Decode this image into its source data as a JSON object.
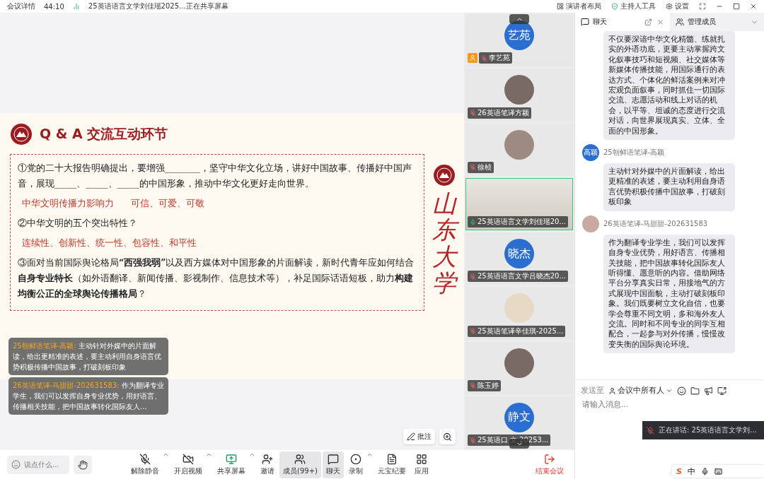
{
  "top_bar": {
    "meeting_info": "会议详情",
    "duration": "44:10",
    "title": "25英语语言文学刘佳瑶2025...正在共享屏幕",
    "actions": [
      {
        "kind": "layout",
        "label": "演讲者布局"
      },
      {
        "kind": "host",
        "label": "主持人工具"
      },
      {
        "kind": "settings",
        "label": "设置"
      }
    ]
  },
  "slide": {
    "title": "Q & A 交流互动环节",
    "side_text": "山东大学",
    "items": [
      {
        "kind": "question",
        "text": "①党的二十大报告明确提出，要增强________，坚守中华文化立场，讲好中国故事、传播好中国声音，展现_____、_____、_____的中国形象，推动中华文化更好走向世界。"
      },
      {
        "kind": "answer",
        "parts": [
          "中华文明传播力影响力",
          "可信、可爱、可敬"
        ]
      },
      {
        "kind": "question",
        "text": "②中华文明的五个突出特性？"
      },
      {
        "kind": "answer",
        "parts": [
          "连续性、创新性、统一性、包容性、和平性"
        ]
      },
      {
        "kind": "question",
        "text": "③面对当前国际舆论格局**“西强我弱”**以及西方媒体对中国形象的片面解读，新时代青年应如何结合**自身专业特长**（如外语翻译、新闻传播、影视制作、信息技术等），补足国际话语短板，助力**构建均衡公正的全球舆论传播格局**？"
      }
    ]
  },
  "overlay_messages": [
    {
      "sender": "25朝鲜语笔译-高颖:",
      "text": "主动针对外媒中的片面解读，给出更精准的表述，要主动利用自身语言优势积极传播中国故事，打破刻板印象"
    },
    {
      "sender": "26英语笔译-马甜甜-202631583:",
      "text": "作为翻译专业学生，我们可以发挥自身专业优势，用好语言、传播相关技能，把中国故事转化国际友人..."
    }
  ],
  "annotate": {
    "label": "批注"
  },
  "participants": [
    {
      "kind": "avatar",
      "avatar_text": "艺苑",
      "name": "李艺苑",
      "muted": true,
      "host": true,
      "speaking": false
    },
    {
      "kind": "photo",
      "name": "26英语笔译方颖",
      "muted": true,
      "host": false,
      "speaking": false
    },
    {
      "kind": "photo",
      "name": "徐桢",
      "muted": true,
      "host": false,
      "speaking": false
    },
    {
      "kind": "video",
      "name": "25英语语言文学刘佳瑶20...",
      "muted": false,
      "host": false,
      "speaking": true
    },
    {
      "kind": "avatar",
      "avatar_text": "晓杰",
      "name": "25英语语言文学吕晓杰20...",
      "muted": true,
      "host": false,
      "speaking": false
    },
    {
      "kind": "photo",
      "name": "25英语笔译辛佳琪-2025...",
      "muted": true,
      "host": false,
      "speaking": false
    },
    {
      "kind": "photo",
      "name": "陈玉婷",
      "muted": true,
      "host": false,
      "speaking": false
    },
    {
      "kind": "avatar",
      "avatar_text": "静文",
      "name": "25英语口 文 20253...",
      "muted": true,
      "host": false,
      "speaking": false
    }
  ],
  "toolbar": {
    "chat_placeholder": "说点什么...",
    "buttons": [
      {
        "kind": "unmute",
        "label": "解除静音",
        "menu": true,
        "active": false
      },
      {
        "kind": "video",
        "label": "开启视频",
        "menu": true,
        "active": false
      },
      {
        "kind": "share",
        "label": "共享屏幕",
        "menu": true,
        "active": false
      },
      {
        "kind": "invite",
        "label": "邀请",
        "menu": false,
        "active": false
      },
      {
        "kind": "members",
        "label": "成员(99+)",
        "menu": false,
        "active": true
      },
      {
        "kind": "chat",
        "label": "聊天",
        "menu": false,
        "active": true
      },
      {
        "kind": "record",
        "label": "录制",
        "menu": true,
        "active": false
      },
      {
        "kind": "summary",
        "label": "元宝纪要",
        "menu": false,
        "active": false
      },
      {
        "kind": "apps",
        "label": "应用",
        "menu": false,
        "active": false
      }
    ],
    "end_label": "结束会议"
  },
  "chat": {
    "tabs": [
      {
        "kind": "chat",
        "label": "聊天",
        "selected": true
      },
      {
        "kind": "members",
        "label": "管理成员",
        "selected": false
      }
    ],
    "messages": [
      {
        "text": "不仅要深谙中华文化精髓、练就扎实的外语功底，更要主动掌握跨文化叙事技巧和短视频、社交媒体等新媒体传播技能，用国际通行的表达方式、个体化的鲜活案例来对冲宏观负面叙事，同时抓住一切国际交流、志愿活动和线上对话的机会，以平等、坦诚的态度进行交流对话，向世界展现真实、立体、全面的中国形象。"
      },
      {
        "sender": "25朝鲜语笔译-高颖",
        "avatar": {
          "kind": "text",
          "text": "高颖"
        },
        "text": "主动针对外媒中的片面解读，给出更精准的表述，要主动利用自身语言优势积极传播中国故事，打破刻板印象"
      },
      {
        "sender": "26英语笔译-马甜甜-202631583",
        "avatar": {
          "kind": "photo"
        },
        "text": "作为翻译专业学生，我们可以发挥自身专业优势，用好语言、传播相关技能，把中国故事转化国际友人听得懂、愿意听的内容。借助网络平台分享真实日常，用接地气的方式展现中国面貌，主动打破刻板印象。我们既要树立文化自信，也要学会尊重不同文明，多和海外友人交流。同时和不同专业的同学互相配合，一起参与对外传播，慢慢改变失衡的国际舆论环境。"
      }
    ],
    "send_to_label": "发送至",
    "recipient": "会议中所有人",
    "placeholder": "请输入消息...",
    "speaking": "正在讲话: 25英语语言文学刘..."
  },
  "ime": {
    "logo": "S",
    "mode": "中"
  }
}
